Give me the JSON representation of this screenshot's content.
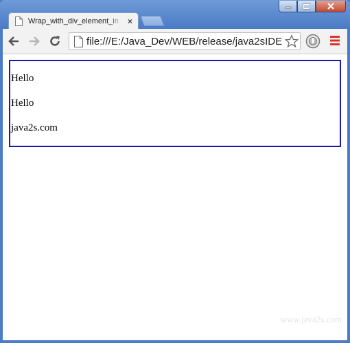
{
  "window": {
    "controls": [
      "minimize",
      "maximize",
      "close"
    ]
  },
  "tab": {
    "title": "Wrap_with_div_element_in",
    "close_glyph": "×"
  },
  "toolbar": {
    "url": "file:///E:/Java_Dev/WEB/release/java2sIDE",
    "icons": [
      "back-icon",
      "forward-icon",
      "reload-icon",
      "page-icon",
      "bookmark-star-icon",
      "extension-icon",
      "menu-icon"
    ]
  },
  "page": {
    "paragraphs": [
      "Hello",
      "Hello",
      "java2s.com"
    ],
    "watermark": "www.java2s.com",
    "colors": {
      "box_border": "#1a1aa6",
      "window_frame": "#4a7ac4"
    }
  }
}
